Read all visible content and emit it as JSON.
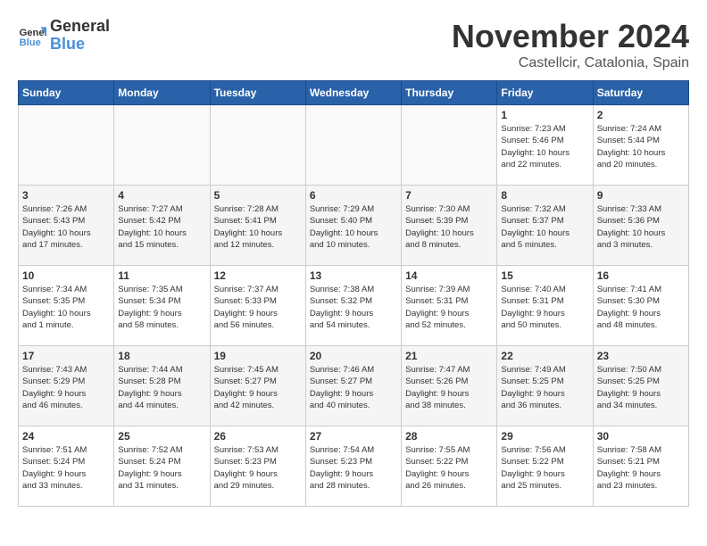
{
  "header": {
    "logo_general": "General",
    "logo_blue": "Blue",
    "month_year": "November 2024",
    "location": "Castellcir, Catalonia, Spain"
  },
  "weekdays": [
    "Sunday",
    "Monday",
    "Tuesday",
    "Wednesday",
    "Thursday",
    "Friday",
    "Saturday"
  ],
  "weeks": [
    [
      {
        "day": "",
        "info": ""
      },
      {
        "day": "",
        "info": ""
      },
      {
        "day": "",
        "info": ""
      },
      {
        "day": "",
        "info": ""
      },
      {
        "day": "",
        "info": ""
      },
      {
        "day": "1",
        "info": "Sunrise: 7:23 AM\nSunset: 5:46 PM\nDaylight: 10 hours\nand 22 minutes."
      },
      {
        "day": "2",
        "info": "Sunrise: 7:24 AM\nSunset: 5:44 PM\nDaylight: 10 hours\nand 20 minutes."
      }
    ],
    [
      {
        "day": "3",
        "info": "Sunrise: 7:26 AM\nSunset: 5:43 PM\nDaylight: 10 hours\nand 17 minutes."
      },
      {
        "day": "4",
        "info": "Sunrise: 7:27 AM\nSunset: 5:42 PM\nDaylight: 10 hours\nand 15 minutes."
      },
      {
        "day": "5",
        "info": "Sunrise: 7:28 AM\nSunset: 5:41 PM\nDaylight: 10 hours\nand 12 minutes."
      },
      {
        "day": "6",
        "info": "Sunrise: 7:29 AM\nSunset: 5:40 PM\nDaylight: 10 hours\nand 10 minutes."
      },
      {
        "day": "7",
        "info": "Sunrise: 7:30 AM\nSunset: 5:39 PM\nDaylight: 10 hours\nand 8 minutes."
      },
      {
        "day": "8",
        "info": "Sunrise: 7:32 AM\nSunset: 5:37 PM\nDaylight: 10 hours\nand 5 minutes."
      },
      {
        "day": "9",
        "info": "Sunrise: 7:33 AM\nSunset: 5:36 PM\nDaylight: 10 hours\nand 3 minutes."
      }
    ],
    [
      {
        "day": "10",
        "info": "Sunrise: 7:34 AM\nSunset: 5:35 PM\nDaylight: 10 hours\nand 1 minute."
      },
      {
        "day": "11",
        "info": "Sunrise: 7:35 AM\nSunset: 5:34 PM\nDaylight: 9 hours\nand 58 minutes."
      },
      {
        "day": "12",
        "info": "Sunrise: 7:37 AM\nSunset: 5:33 PM\nDaylight: 9 hours\nand 56 minutes."
      },
      {
        "day": "13",
        "info": "Sunrise: 7:38 AM\nSunset: 5:32 PM\nDaylight: 9 hours\nand 54 minutes."
      },
      {
        "day": "14",
        "info": "Sunrise: 7:39 AM\nSunset: 5:31 PM\nDaylight: 9 hours\nand 52 minutes."
      },
      {
        "day": "15",
        "info": "Sunrise: 7:40 AM\nSunset: 5:31 PM\nDaylight: 9 hours\nand 50 minutes."
      },
      {
        "day": "16",
        "info": "Sunrise: 7:41 AM\nSunset: 5:30 PM\nDaylight: 9 hours\nand 48 minutes."
      }
    ],
    [
      {
        "day": "17",
        "info": "Sunrise: 7:43 AM\nSunset: 5:29 PM\nDaylight: 9 hours\nand 46 minutes."
      },
      {
        "day": "18",
        "info": "Sunrise: 7:44 AM\nSunset: 5:28 PM\nDaylight: 9 hours\nand 44 minutes."
      },
      {
        "day": "19",
        "info": "Sunrise: 7:45 AM\nSunset: 5:27 PM\nDaylight: 9 hours\nand 42 minutes."
      },
      {
        "day": "20",
        "info": "Sunrise: 7:46 AM\nSunset: 5:27 PM\nDaylight: 9 hours\nand 40 minutes."
      },
      {
        "day": "21",
        "info": "Sunrise: 7:47 AM\nSunset: 5:26 PM\nDaylight: 9 hours\nand 38 minutes."
      },
      {
        "day": "22",
        "info": "Sunrise: 7:49 AM\nSunset: 5:25 PM\nDaylight: 9 hours\nand 36 minutes."
      },
      {
        "day": "23",
        "info": "Sunrise: 7:50 AM\nSunset: 5:25 PM\nDaylight: 9 hours\nand 34 minutes."
      }
    ],
    [
      {
        "day": "24",
        "info": "Sunrise: 7:51 AM\nSunset: 5:24 PM\nDaylight: 9 hours\nand 33 minutes."
      },
      {
        "day": "25",
        "info": "Sunrise: 7:52 AM\nSunset: 5:24 PM\nDaylight: 9 hours\nand 31 minutes."
      },
      {
        "day": "26",
        "info": "Sunrise: 7:53 AM\nSunset: 5:23 PM\nDaylight: 9 hours\nand 29 minutes."
      },
      {
        "day": "27",
        "info": "Sunrise: 7:54 AM\nSunset: 5:23 PM\nDaylight: 9 hours\nand 28 minutes."
      },
      {
        "day": "28",
        "info": "Sunrise: 7:55 AM\nSunset: 5:22 PM\nDaylight: 9 hours\nand 26 minutes."
      },
      {
        "day": "29",
        "info": "Sunrise: 7:56 AM\nSunset: 5:22 PM\nDaylight: 9 hours\nand 25 minutes."
      },
      {
        "day": "30",
        "info": "Sunrise: 7:58 AM\nSunset: 5:21 PM\nDaylight: 9 hours\nand 23 minutes."
      }
    ]
  ]
}
